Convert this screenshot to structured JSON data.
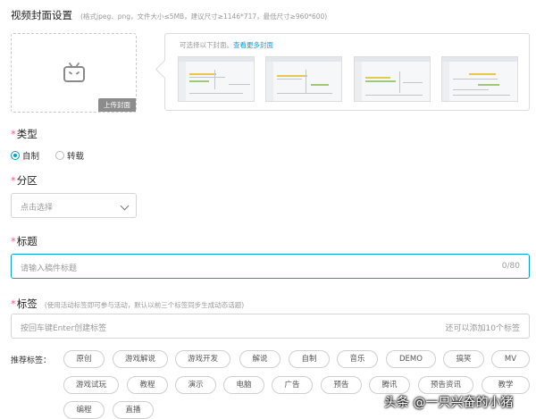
{
  "cover": {
    "title": "视频封面设置",
    "hint": "(格式jpeg、png，文件大小≤5MB，建议尺寸≥1146*717，最低尺寸≥960*600)",
    "upload_label": "上传封面",
    "select_hint": "可选择以下封面。",
    "more_link": "查看更多封面"
  },
  "type": {
    "required_mark": "*",
    "label": "类型",
    "options": [
      "自制",
      "转载"
    ],
    "selected": "自制"
  },
  "zone": {
    "required_mark": "*",
    "label": "分区",
    "placeholder": "点击选择"
  },
  "title_field": {
    "required_mark": "*",
    "label": "标题",
    "placeholder": "请输入稿件标题",
    "counter": "0/80"
  },
  "tags_field": {
    "required_mark": "*",
    "label": "标签",
    "hint": "(使用活动标签即可参与活动，默认以前三个标签同步生成动态话题)",
    "placeholder": "按回车键Enter创建标签",
    "remaining": "还可以添加10个标签"
  },
  "recommended": {
    "label": "推荐标签：",
    "tags": [
      "原创",
      "游戏解说",
      "游戏开发",
      "解说",
      "自制",
      "音乐",
      "DEMO",
      "搞笑",
      "MV",
      "游戏试玩",
      "教程",
      "演示",
      "电脑",
      "广告",
      "预告",
      "腾讯",
      "预告资讯",
      "教学",
      "编程",
      "直播"
    ]
  },
  "watermark": "头条 @一只兴奋的小猪",
  "colors": {
    "accent": "#00a1d6",
    "required": "#f25d8e"
  }
}
